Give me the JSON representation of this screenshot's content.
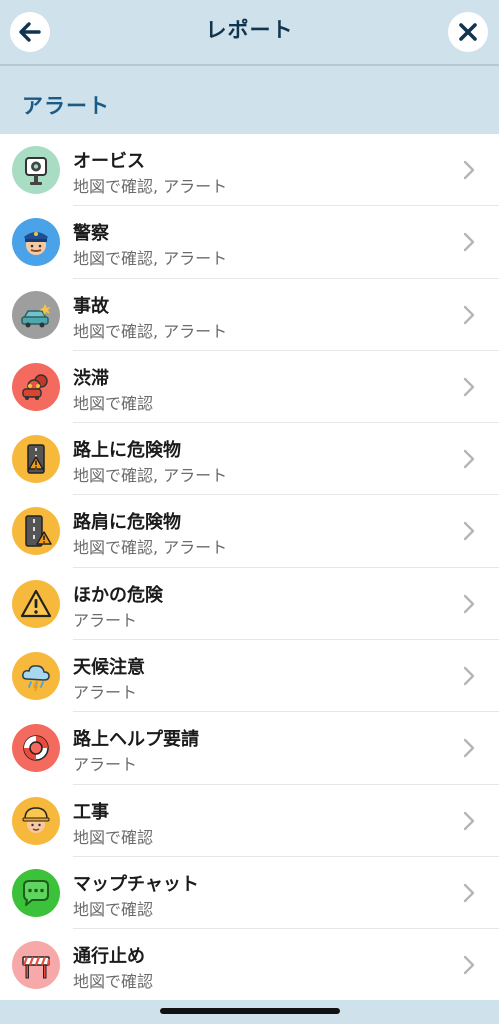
{
  "header": {
    "title": "レポート",
    "back_icon": "arrow-left-icon",
    "close_icon": "close-icon"
  },
  "section": {
    "title": "アラート"
  },
  "items": [
    {
      "label": "オービス",
      "sub": "地図で確認, アラート",
      "icon": "speed-camera-icon",
      "color": "#a8dcc3"
    },
    {
      "label": "警察",
      "sub": "地図で確認, アラート",
      "icon": "police-icon",
      "color": "#4aa3e8"
    },
    {
      "label": "事故",
      "sub": "地図で確認, アラート",
      "icon": "accident-icon",
      "color": "#9e9e9e"
    },
    {
      "label": "渋滞",
      "sub": "地図で確認",
      "icon": "traffic-jam-icon",
      "color": "#f46a5e"
    },
    {
      "label": "路上に危険物",
      "sub": "地図で確認, アラート",
      "icon": "road-hazard-icon",
      "color": "#f6b93b"
    },
    {
      "label": "路肩に危険物",
      "sub": "地図で確認, アラート",
      "icon": "shoulder-hazard-icon",
      "color": "#f6b93b"
    },
    {
      "label": "ほかの危険",
      "sub": "アラート",
      "icon": "warning-icon",
      "color": "#f6b93b"
    },
    {
      "label": "天候注意",
      "sub": "アラート",
      "icon": "weather-icon",
      "color": "#f6b93b"
    },
    {
      "label": "路上ヘルプ要請",
      "sub": "アラート",
      "icon": "lifebuoy-icon",
      "color": "#f46a5e"
    },
    {
      "label": "工事",
      "sub": "地図で確認",
      "icon": "construction-worker-icon",
      "color": "#f6b93b"
    },
    {
      "label": "マップチャット",
      "sub": "地図で確認",
      "icon": "chat-bubble-icon",
      "color": "#3cc13b"
    },
    {
      "label": "通行止め",
      "sub": "地図で確認",
      "icon": "road-closed-icon",
      "color": "#f7a8a8"
    }
  ]
}
